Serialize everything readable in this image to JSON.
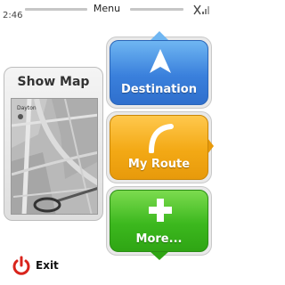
{
  "status": {
    "time": "2:46",
    "title": "Menu"
  },
  "map_card": {
    "title": "Show Map",
    "street_label": "Dayton"
  },
  "buttons": {
    "destination": "Destination",
    "my_route": "My Route",
    "more": "More..."
  },
  "footer": {
    "exit_label": "Exit"
  },
  "colors": {
    "destination": "#3a80dc",
    "my_route": "#f3a915",
    "more": "#3cb81e",
    "exit_icon": "#d9241c"
  },
  "icons": {
    "status": "signal-off-icon",
    "destination": "navigation-arrow-icon",
    "my_route": "route-curve-icon",
    "more": "plus-icon",
    "exit": "power-icon"
  }
}
